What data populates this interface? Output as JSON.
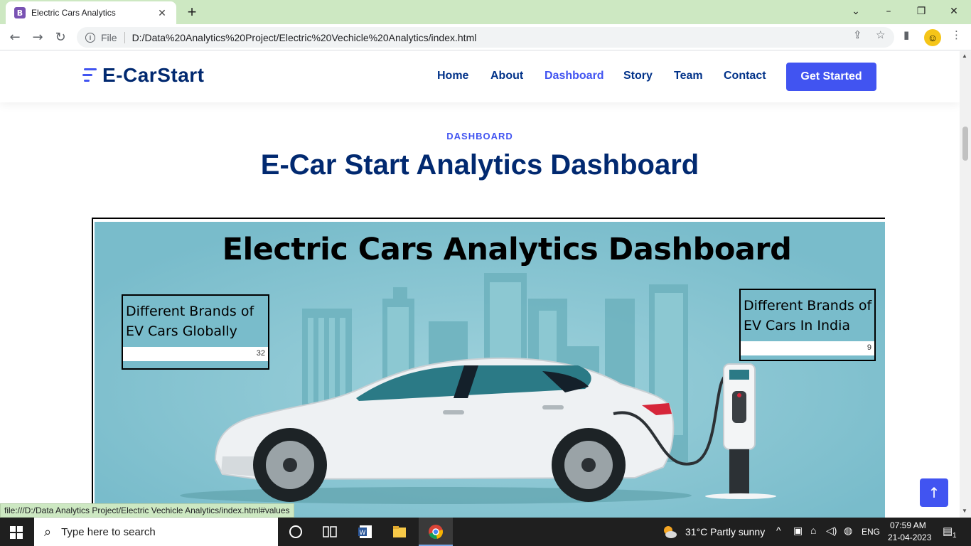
{
  "browser": {
    "tab_title": "Electric Cars Analytics",
    "tab_favicon": "B",
    "new_tab": "+",
    "close_tab": "✕",
    "file_label": "File",
    "url": "D:/Data%20Analytics%20Project/Electric%20Vechicle%20Analytics/index.html",
    "status_url": "file:///D:/Data Analytics Project/Electric Vechicle Analytics/index.html#values"
  },
  "site": {
    "logo": "E-CarStart",
    "nav": [
      "Home",
      "About",
      "Dashboard",
      "Story",
      "Team",
      "Contact"
    ],
    "active_nav": "Dashboard",
    "cta": "Get Started",
    "section_label": "DASHBOARD",
    "section_title": "E-Car Start Analytics Dashboard",
    "accent_color": "#4154f1",
    "heading_color": "#012970"
  },
  "dashboard": {
    "title": "Electric Cars Analytics Dashboard",
    "cards": [
      {
        "label": "Different Brands of EV Cars Globally",
        "value": "32"
      },
      {
        "label": "Different Brands of EV Cars In India",
        "value": "9"
      }
    ],
    "background_color": "#79bccb"
  },
  "taskbar": {
    "search_placeholder": "Type here to search",
    "weather": "31°C  Partly sunny",
    "lang": "ENG",
    "time": "07:59 AM",
    "date": "21-04-2023",
    "notif_count": "1"
  }
}
